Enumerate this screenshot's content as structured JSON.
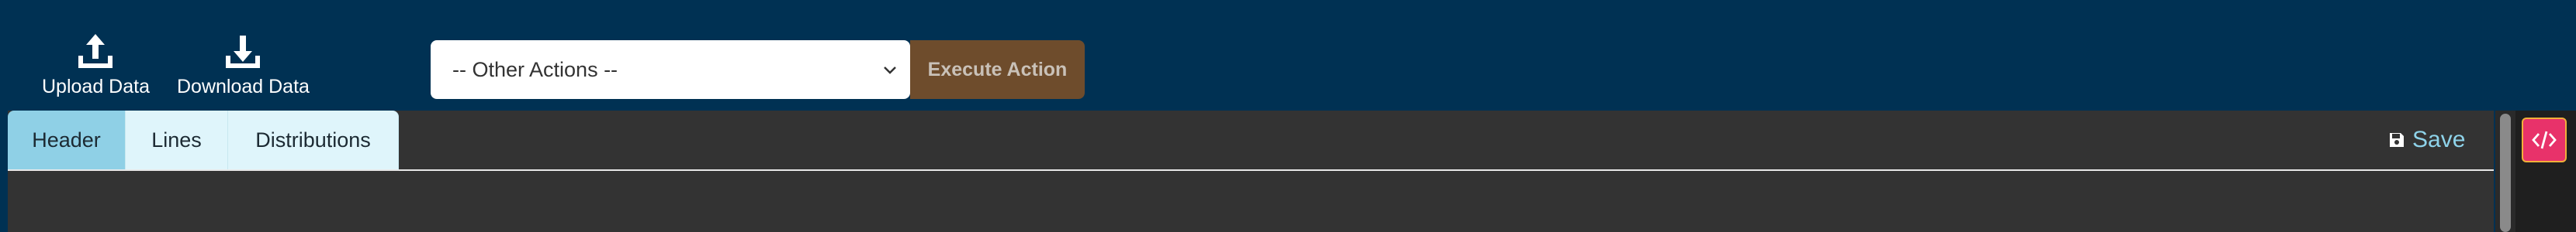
{
  "toolbar": {
    "upload_label": "Upload Data",
    "download_label": "Download Data",
    "actions_select_value": "-- Other Actions --",
    "execute_label": "Execute Action"
  },
  "tabs": [
    {
      "label": "Header",
      "active": true
    },
    {
      "label": "Lines",
      "active": false
    },
    {
      "label": "Distributions",
      "active": false
    }
  ],
  "save_label": "Save",
  "colors": {
    "topbar_bg": "#003153",
    "execute_bg": "#6e4c2c",
    "tab_active_bg": "#8fd0e6",
    "tab_bg": "#dff5fb",
    "editor_bg": "#333333",
    "save_color": "#8ed3ea",
    "code_btn_bg": "#e8326a"
  },
  "icons": {
    "upload": "upload-icon",
    "download": "download-icon",
    "chevron": "chevron-down-icon",
    "save": "floppy-disk-icon",
    "code": "code-icon"
  }
}
